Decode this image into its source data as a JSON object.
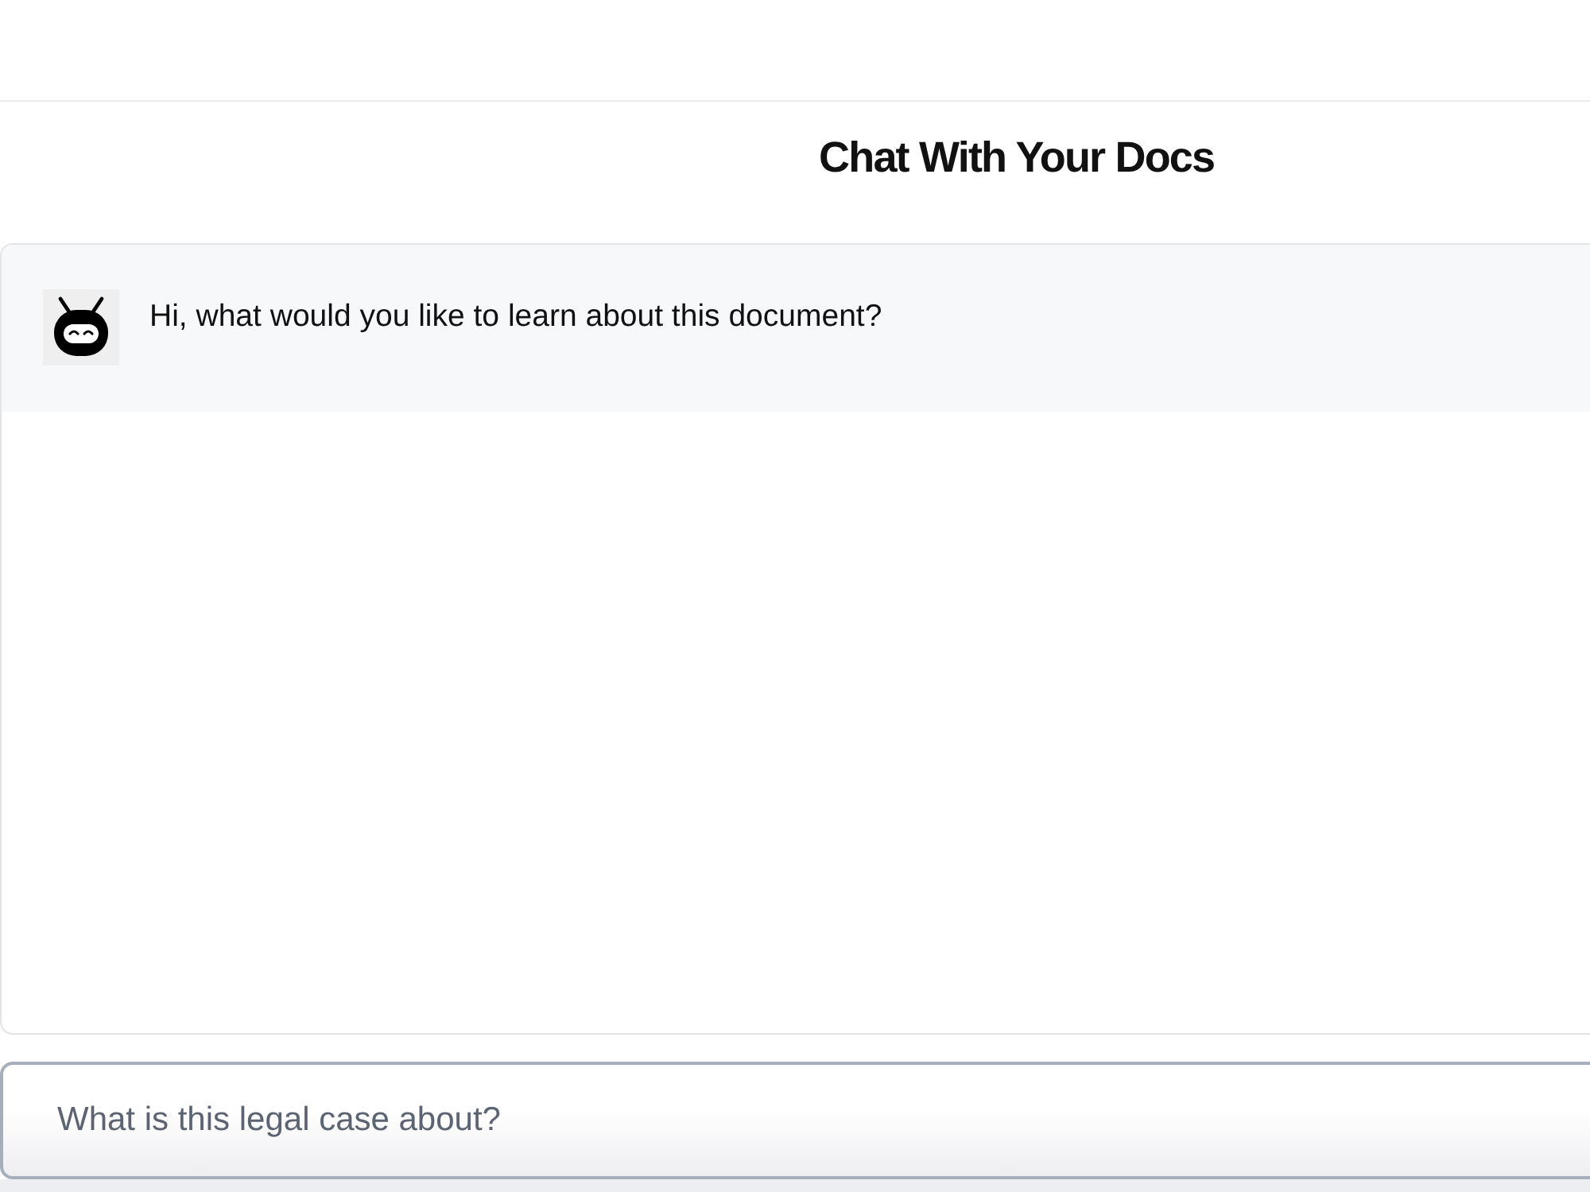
{
  "header": {
    "title": "Chat With Your Docs"
  },
  "messages": [
    {
      "kind": "bot",
      "text": "Hi, what would you like to learn about this document?"
    }
  ],
  "input": {
    "placeholder": "What is this legal case about?"
  }
}
